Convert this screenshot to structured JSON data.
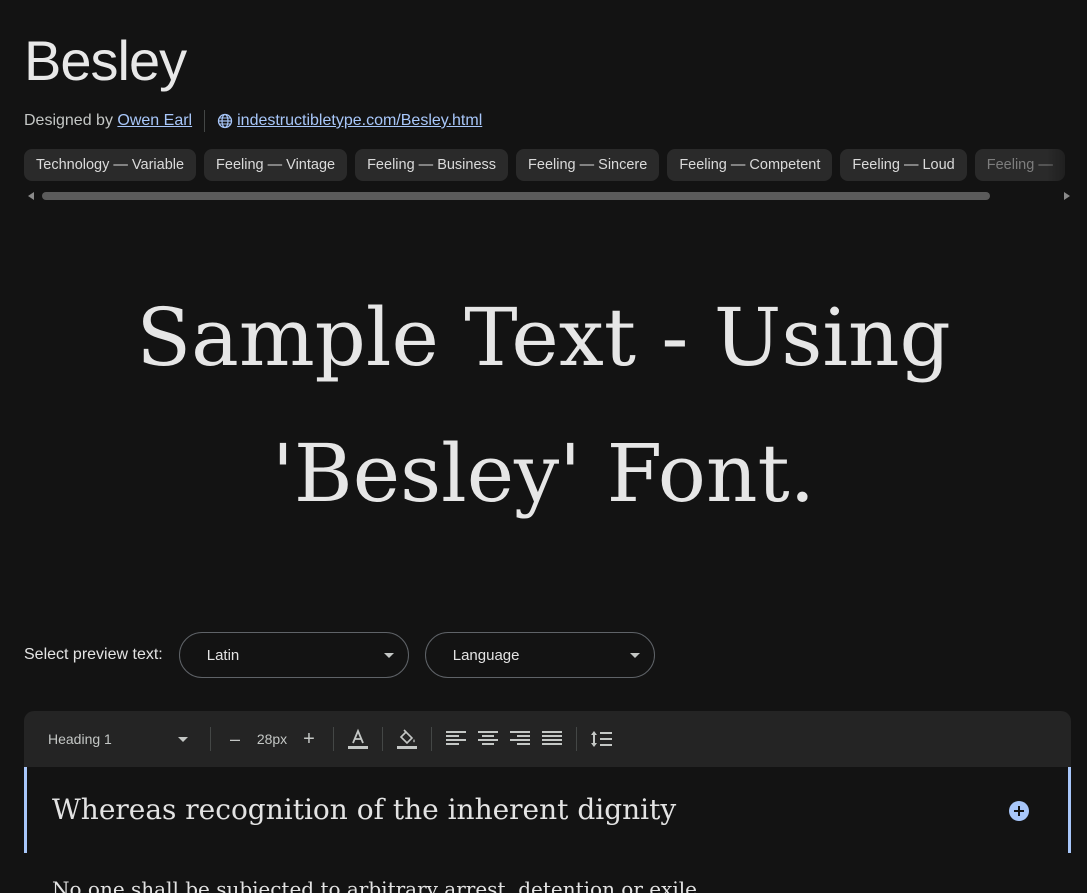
{
  "font": {
    "name": "Besley",
    "designed_by_label": "Designed by",
    "designer": "Owen Earl",
    "website": "indestructibletype.com/Besley.html"
  },
  "tags": [
    "Technology — Variable",
    "Feeling — Vintage",
    "Feeling — Business",
    "Feeling — Sincere",
    "Feeling — Competent",
    "Feeling — Loud",
    "Feeling —"
  ],
  "sample": {
    "line1": "Sample Text - Using",
    "line2": "'Besley' Font."
  },
  "preview": {
    "label": "Select preview text:",
    "script_value": "Latin",
    "language_value": "Language"
  },
  "toolbar": {
    "style_value": "Heading 1",
    "decrease_label": "–",
    "size_value": "28px",
    "increase_label": "+"
  },
  "editor": {
    "heading_text": "Whereas recognition of the inherent dignity",
    "next_line": "No one shall be subjected to arbitrary arrest, detention or exile."
  },
  "colors": {
    "background": "#131313",
    "link": "#a8c7fa",
    "accent": "#a8c7fa"
  }
}
